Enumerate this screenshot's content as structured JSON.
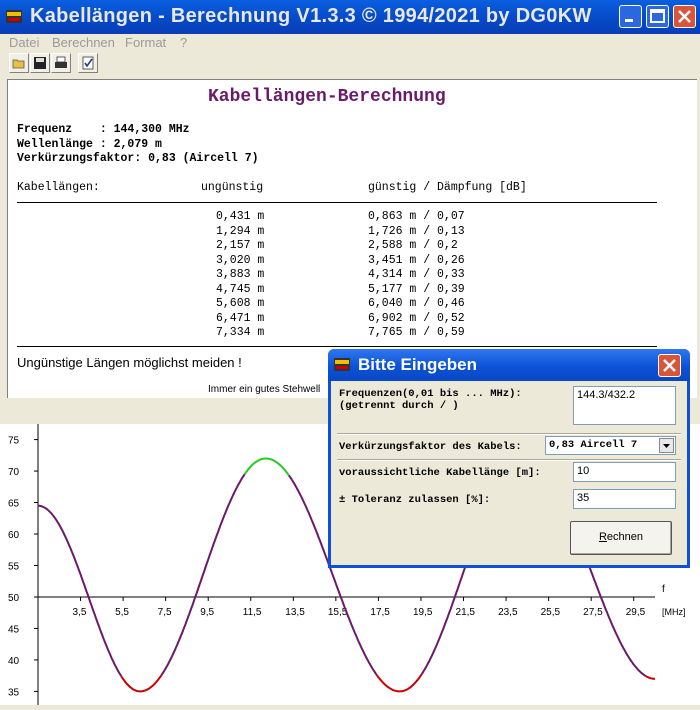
{
  "window": {
    "title": "Kabellängen - Berechnung V1.3.3 © 1994/2021 by DG0KW"
  },
  "menu": [
    "Datei",
    "Berechnen",
    "Format",
    "?"
  ],
  "toolbar": {
    "icons": [
      "open-icon",
      "save-icon",
      "print-icon",
      "check-icon"
    ]
  },
  "report": {
    "title": "Kabellängen-Berechnung",
    "frequenz": "Frequenz    : 144,300 MHz",
    "wellenlaenge": "Wellenlänge : 2,079 m",
    "verkuerzung": "Verkürzungsfaktor: 0,83 (Aircell 7)",
    "col_label": "Kabellängen:",
    "col_ungunstig": "ungünstig",
    "col_gunstig": "günstig / Dämpfung [dB]",
    "rows": [
      {
        "u": "0,431 m",
        "g": "0,863 m / 0,07"
      },
      {
        "u": "1,294 m",
        "g": "1,726 m / 0,13"
      },
      {
        "u": "2,157 m",
        "g": "2,588 m / 0,2"
      },
      {
        "u": "3,020 m",
        "g": "3,451 m / 0,26"
      },
      {
        "u": "3,883 m",
        "g": "4,314 m / 0,33"
      },
      {
        "u": "4,745 m",
        "g": "5,177 m / 0,39"
      },
      {
        "u": "5,608 m",
        "g": "6,040 m / 0,46"
      },
      {
        "u": "6,471 m",
        "g": "6,902 m / 0,52"
      },
      {
        "u": "7,334 m",
        "g": "7,765 m / 0,59"
      }
    ],
    "note": "Ungünstige Längen möglichst meiden !",
    "footer": "Immer ein gutes Stehwell"
  },
  "dialog": {
    "title": "Bitte Eingeben",
    "freq_label": "Frequenzen(0,01 bis ... MHz):\n(getrennt durch / )",
    "freq_value": "144.3/432.2",
    "vf_label": "Verkürzungsfaktor des Kabels:",
    "vf_value": "0,83 Aircell 7",
    "length_label": "voraussichtliche Kabellänge [m]:",
    "length_value": "10",
    "tol_label": "± Toleranz zulassen [%]:",
    "tol_value": "35",
    "button": "Rechnen"
  },
  "chart_data": {
    "type": "line",
    "x_axis_title": "f",
    "x_unit": "[MHz]",
    "x_ticks": [
      "3,5",
      "5,5",
      "7,5",
      "9,5",
      "11,5",
      "13,5",
      "15,5",
      "17,5",
      "19,5",
      "21,5",
      "23,5",
      "25,5",
      "27,5",
      "29,5"
    ],
    "y_ticks": [
      "75",
      "70",
      "65",
      "60",
      "55",
      "50",
      "45",
      "40",
      "35"
    ],
    "xlim": [
      1.5,
      30.5
    ],
    "ylim": [
      33,
      77
    ],
    "series": [
      {
        "points": [
          [
            1.5,
            64.5
          ],
          [
            6.3,
            35
          ],
          [
            12.2,
            72
          ],
          [
            18.5,
            35
          ],
          [
            24.4,
            72
          ],
          [
            30.5,
            37
          ]
        ]
      }
    ],
    "colors": {
      "curve": "#6b1a6b",
      "low": "#cc0000",
      "high": "#22cc22"
    }
  }
}
